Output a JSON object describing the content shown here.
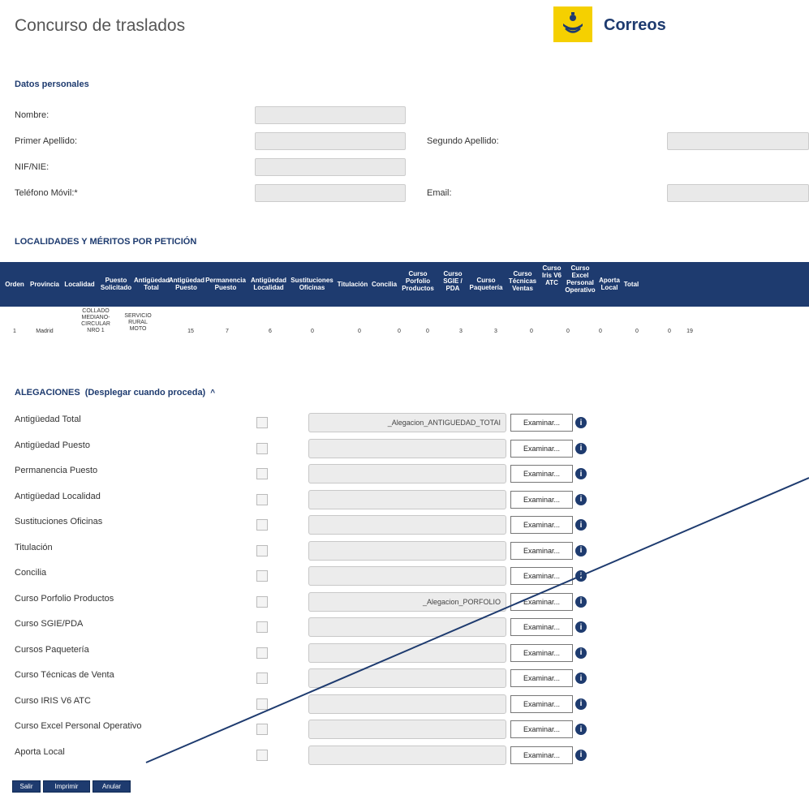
{
  "header": {
    "title": "Concurso de traslados",
    "brand": "Correos"
  },
  "personal": {
    "section_title": "Datos personales",
    "nombre_label": "Nombre:",
    "primer_apellido_label": "Primer Apellido:",
    "segundo_apellido_label": "Segundo Apellido:",
    "nif_label": "NIF/NIE:",
    "telefono_label": "Teléfono Móvil:*",
    "email_label": "Email:"
  },
  "localidades": {
    "section_title": "LOCALIDADES Y MÉRITOS POR PETICIÓN",
    "columns": [
      "Orden",
      "Provincia",
      "Localidad",
      "Puesto Solicitado",
      "Antigüedad Total",
      "Antigüedad Puesto",
      "Permanencia Puesto",
      "Antigüedad Localidad",
      "Sustituciones Oficinas",
      "Titulación",
      "Concilia",
      "Curso Porfolio Productos",
      "Curso SGIE / PDA",
      "Curso Paquetería",
      "Curso Técnicas Ventas",
      "Curso Iris V6 ATC",
      "Curso Excel Personal Operativo",
      "Aporta Local",
      "Total"
    ],
    "row": [
      "1",
      "Madrid",
      "COLLADO MEDIANO-CIRCULAR NRO 1",
      "SERVICIO RURAL MOTO",
      "15",
      "7",
      "6",
      "0",
      "0",
      "0",
      "0",
      "3",
      "3",
      "0",
      "0",
      "0",
      "0",
      "0",
      "19"
    ]
  },
  "alegaciones": {
    "title": "ALEGACIONES",
    "subtitle": "(Desplegar cuando proceda)",
    "browse_label": "Examinar...",
    "info_glyph": "i",
    "items": [
      {
        "label": "Antigüedad Total",
        "file": "_Alegacion_ANTIGUEDAD_TOTAI"
      },
      {
        "label": "Antigüedad Puesto",
        "file": ""
      },
      {
        "label": "Permanencia Puesto",
        "file": ""
      },
      {
        "label": "Antigüedad Localidad",
        "file": ""
      },
      {
        "label": "Sustituciones Oficinas",
        "file": ""
      },
      {
        "label": "Titulación",
        "file": ""
      },
      {
        "label": "Concilia",
        "file": ""
      },
      {
        "label": "Curso Porfolio Productos",
        "file": "_Alegacion_PORFOLIO"
      },
      {
        "label": "Curso SGIE/PDA",
        "file": ""
      },
      {
        "label": "Cursos Paquetería",
        "file": ""
      },
      {
        "label": "Curso Técnicas de Venta",
        "file": ""
      },
      {
        "label": "Curso IRIS V6 ATC",
        "file": ""
      },
      {
        "label": "Curso Excel Personal Operativo",
        "file": ""
      },
      {
        "label": "Aporta Local",
        "file": ""
      }
    ]
  },
  "footer": {
    "salir": "Salir",
    "imprimir": "Imprimir",
    "anular": "Anular"
  },
  "colors": {
    "navy": "#1e3b6f",
    "yellow": "#f5d000"
  }
}
